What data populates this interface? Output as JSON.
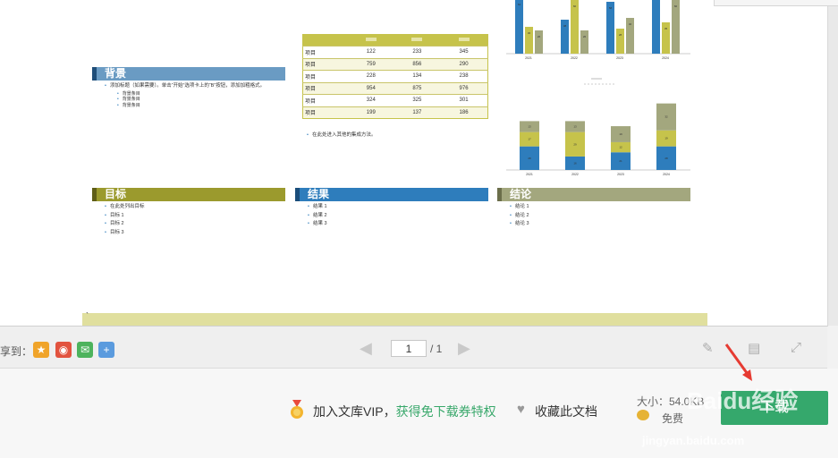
{
  "poster": {
    "background": {
      "title": "背景",
      "color": "#6a9bc3",
      "items": [
        "添加标题（如果需要）。单击“开始”选项卡上的“B”按钮，添加加粗格式。"
      ],
      "subitems": [
        "背景条目",
        "背景条目",
        "背景条目"
      ]
    },
    "goal": {
      "title": "目标",
      "color": "#9b9a2d",
      "items": [
        "在此处列出目标",
        "目标 1",
        "目标 2",
        "目标 3"
      ]
    },
    "result": {
      "title": "结果",
      "color": "#2e7dbc",
      "items": [
        "结果 1",
        "结果 2",
        "结果 3"
      ]
    },
    "conclusion": {
      "title": "结论",
      "color": "#a3a77e",
      "items": [
        "结论 1",
        "结论 2",
        "结论 3"
      ]
    },
    "table": {
      "rows": [
        [
          "项目",
          "122",
          "233",
          "345"
        ],
        [
          "项目",
          "759",
          "856",
          "290"
        ],
        [
          "项目",
          "228",
          "134",
          "238"
        ],
        [
          "项目",
          "954",
          "875",
          "976"
        ],
        [
          "项目",
          "324",
          "325",
          "301"
        ],
        [
          "项目",
          "199",
          "137",
          "186"
        ]
      ],
      "note": "在此处进入其他的集成方法。"
    },
    "footer_mark": "`"
  },
  "chart_data": [
    {
      "type": "bar",
      "categories": [
        "2021",
        "2022",
        "2023",
        "2024"
      ],
      "series": [
        {
          "values": [
            62,
            38,
            58,
            68
          ],
          "color": "#2e7dbc"
        },
        {
          "values": [
            30,
            60,
            28,
            35
          ],
          "color": "#c6c34b"
        },
        {
          "values": [
            26,
            26,
            40,
            60
          ],
          "color": "#a3a77e"
        }
      ],
      "ylim": [
        0,
        70
      ]
    },
    {
      "type": "bar",
      "stacked": true,
      "categories": [
        "2021",
        "2022",
        "2023",
        "2024"
      ],
      "series": [
        {
          "values": [
            28,
            16,
            21,
            28
          ],
          "color": "#2e7dbc"
        },
        {
          "values": [
            17,
            29,
            12,
            19
          ],
          "color": "#c6c34b"
        },
        {
          "values": [
            13,
            13,
            19,
            32
          ],
          "color": "#a3a77e"
        }
      ],
      "ylim": [
        0,
        85
      ]
    }
  ],
  "toolbar": {
    "share_label": "享到：",
    "share_icons": [
      "star-icon",
      "weibo-icon",
      "wechat-icon",
      "plus-icon"
    ],
    "page_current": "1",
    "page_total": "/ 1"
  },
  "bottom": {
    "vip_text": "加入文库VIP，",
    "vip_link": "获得免下载券特权",
    "favorite_label": "收藏此文档",
    "size_text": "大小：54.0KB",
    "price_label": "免费",
    "download_label": "下载"
  },
  "watermark": {
    "brand": "Baidu经验",
    "url": "jingyan.baidu.com"
  },
  "colors": {
    "download": "#35a86c",
    "link": "#39a86b",
    "arrow": "#e63b32"
  }
}
